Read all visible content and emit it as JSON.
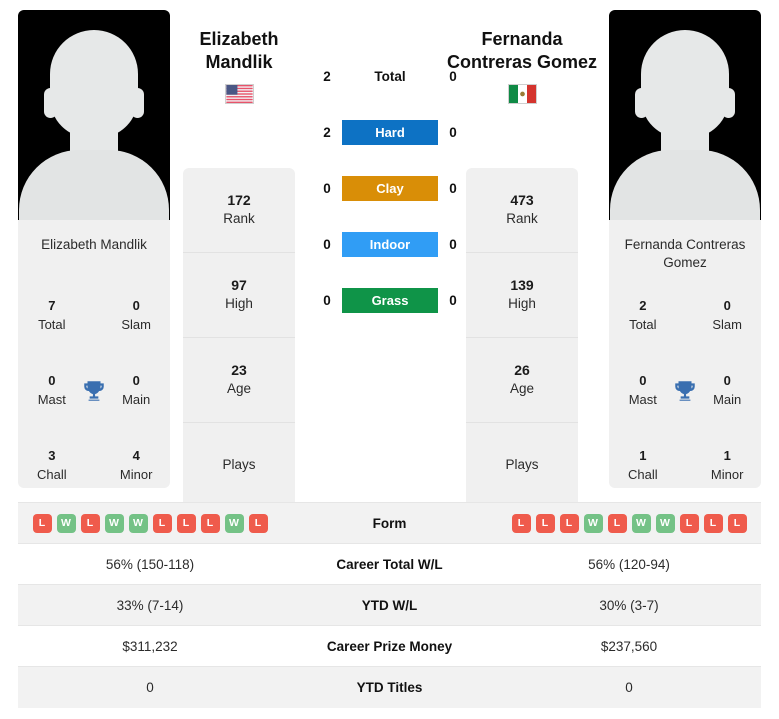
{
  "players": {
    "left": {
      "name": "Elizabeth Mandlik",
      "display_name_line1": "Elizabeth",
      "display_name_line2": "Mandlik",
      "flag": "us-flag-icon",
      "flag_country": "United States",
      "titles": {
        "total": "7",
        "total_label": "Total",
        "slam": "0",
        "slam_label": "Slam",
        "mast": "0",
        "mast_label": "Mast",
        "main": "0",
        "main_label": "Main",
        "chall": "3",
        "chall_label": "Chall",
        "minor": "4",
        "minor_label": "Minor"
      },
      "stats": [
        {
          "value": "172",
          "label": "Rank"
        },
        {
          "value": "97",
          "label": "High"
        },
        {
          "value": "23",
          "label": "Age"
        },
        {
          "value": "",
          "label": "Plays"
        }
      ],
      "form": [
        "L",
        "W",
        "L",
        "W",
        "W",
        "L",
        "L",
        "L",
        "W",
        "L"
      ],
      "career_total_wl": "56% (150-118)",
      "ytd_wl": "33% (7-14)",
      "career_prize_money": "$311,232",
      "ytd_titles": "0"
    },
    "right": {
      "name": "Fernanda Contreras Gomez",
      "display_name_line1": "Fernanda",
      "display_name_line2": "Contreras Gomez",
      "flag": "mx-flag-icon",
      "flag_country": "Mexico",
      "titles": {
        "total": "2",
        "total_label": "Total",
        "slam": "0",
        "slam_label": "Slam",
        "mast": "0",
        "mast_label": "Mast",
        "main": "0",
        "main_label": "Main",
        "chall": "1",
        "chall_label": "Chall",
        "minor": "1",
        "minor_label": "Minor"
      },
      "stats": [
        {
          "value": "473",
          "label": "Rank"
        },
        {
          "value": "139",
          "label": "High"
        },
        {
          "value": "26",
          "label": "Age"
        },
        {
          "value": "",
          "label": "Plays"
        }
      ],
      "form": [
        "L",
        "L",
        "L",
        "W",
        "L",
        "W",
        "W",
        "L",
        "L",
        "L"
      ],
      "career_total_wl": "56% (120-94)",
      "ytd_wl": "30% (3-7)",
      "career_prize_money": "$237,560",
      "ytd_titles": "0"
    }
  },
  "h2h": [
    {
      "label": "Total",
      "left": "2",
      "right": "0",
      "color": ""
    },
    {
      "label": "Hard",
      "left": "2",
      "right": "0",
      "color": "#0d72c4"
    },
    {
      "label": "Clay",
      "left": "0",
      "right": "0",
      "color": "#d98e07"
    },
    {
      "label": "Indoor",
      "left": "0",
      "right": "0",
      "color": "#309df5"
    },
    {
      "label": "Grass",
      "left": "0",
      "right": "0",
      "color": "#0f9448"
    }
  ],
  "table_rows": [
    {
      "label": "Form",
      "left": "",
      "right": "",
      "type": "form"
    },
    {
      "label": "Career Total W/L",
      "left": "56% (150-118)",
      "right": "56% (120-94)",
      "type": "text"
    },
    {
      "label": "YTD W/L",
      "left": "33% (7-14)",
      "right": "30% (3-7)",
      "type": "text"
    },
    {
      "label": "Career Prize Money",
      "left": "$311,232",
      "right": "$237,560",
      "type": "text"
    },
    {
      "label": "YTD Titles",
      "left": "0",
      "right": "0",
      "type": "text"
    }
  ],
  "colors": {
    "win_badge": "#74c286",
    "loss_badge": "#ef5b4c",
    "trophy": "#3a6fb0",
    "card_bg": "#f0f0f0",
    "row_shaded": "#f2f2f2"
  },
  "icons": {
    "trophy": "trophy-icon"
  }
}
